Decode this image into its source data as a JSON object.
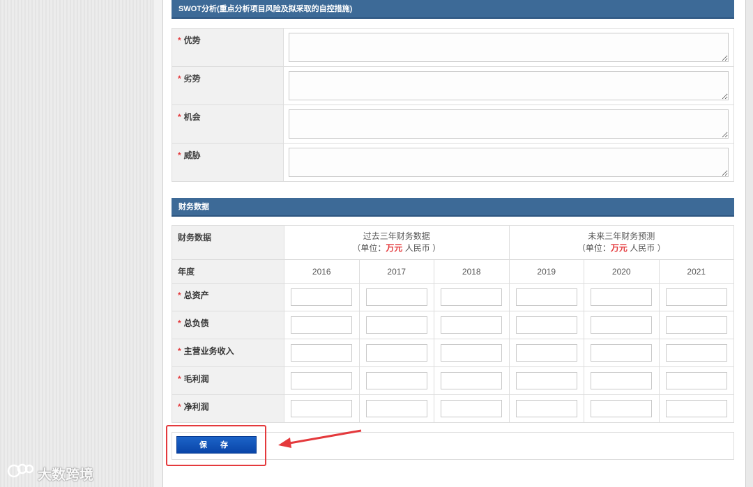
{
  "swot": {
    "title": "SWOT分析(重点分析项目风险及拟采取的自控措施)",
    "required_mark": "*",
    "items": [
      {
        "label": "优势",
        "value": ""
      },
      {
        "label": "劣势",
        "value": ""
      },
      {
        "label": "机会",
        "value": ""
      },
      {
        "label": "威胁",
        "value": ""
      }
    ]
  },
  "finance": {
    "title": "财务数据",
    "header_label": "财务数据",
    "past": {
      "title": "过去三年财务数据",
      "unit_prefix": "（单位：",
      "unit_red": "万元",
      "unit_suffix": " 人民币 ）"
    },
    "future": {
      "title": "未来三年财务预测",
      "unit_prefix": "（单位：",
      "unit_red": "万元",
      "unit_suffix": " 人民币 ）"
    },
    "year_label": "年度",
    "years": [
      "2016",
      "2017",
      "2018",
      "2019",
      "2020",
      "2021"
    ],
    "rows": [
      {
        "label": "总资产"
      },
      {
        "label": "总负债"
      },
      {
        "label": "主营业务收入"
      },
      {
        "label": "毛利润"
      },
      {
        "label": "净利润"
      }
    ]
  },
  "actions": {
    "save_label": "保 存"
  },
  "annotation": {
    "highlight_color": "#e4393c"
  },
  "watermark": {
    "text": "大数跨境"
  },
  "colors": {
    "section_bar": "#3d6a97",
    "required": "#e4393c",
    "save_button": "#1556b8"
  }
}
